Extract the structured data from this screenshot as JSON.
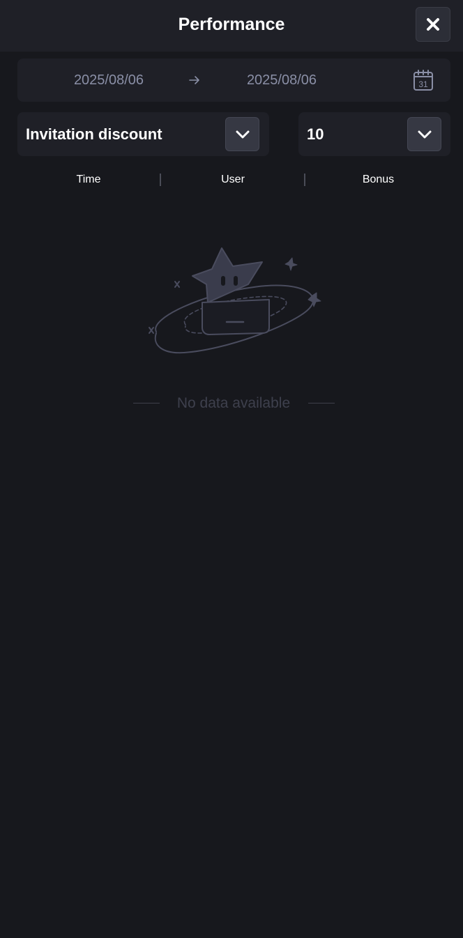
{
  "header": {
    "title": "Performance",
    "close_icon": "close-icon"
  },
  "date_range": {
    "start": "2025/08/06",
    "end": "2025/08/06",
    "separator_icon": "arrow-right-icon",
    "calendar_icon": "calendar-icon",
    "calendar_day": "31"
  },
  "filters": {
    "type": {
      "value": "Invitation discount",
      "icon": "chevron-down-icon"
    },
    "page_size": {
      "value": "10",
      "icon": "chevron-down-icon"
    }
  },
  "table": {
    "columns": [
      "Time",
      "User",
      "Bonus"
    ],
    "rows": []
  },
  "empty_state": {
    "text": "No data available",
    "illustration": "empty-star-box-illustration"
  },
  "colors": {
    "background": "#17181d",
    "panel": "#1f2027",
    "button": "#363843",
    "muted_text": "#8a8fa6",
    "empty_text": "#3e404d"
  }
}
